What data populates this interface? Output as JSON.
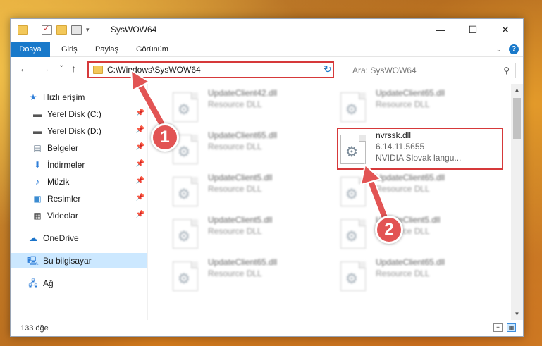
{
  "window": {
    "title": "SysWOW64",
    "controls": {
      "minimize": "—",
      "maximize": "☐",
      "close": "✕"
    }
  },
  "ribbon": {
    "tabs": [
      "Dosya",
      "Giriş",
      "Paylaş",
      "Görünüm"
    ],
    "accent": "#1979ca"
  },
  "nav": {
    "back": "←",
    "forward": "→",
    "recent": "⌄",
    "up": "↑",
    "address": "C:\\Windows\\SysWOW64",
    "search_placeholder": "Ara: SysWOW64"
  },
  "sidebar": {
    "items": [
      {
        "label": "Hızlı erişim",
        "icon": "star-icon",
        "pinned": false
      },
      {
        "label": "Yerel Disk (C:)",
        "icon": "drive-icon",
        "pinned": true
      },
      {
        "label": "Yerel Disk (D:)",
        "icon": "drive-icon",
        "pinned": true
      },
      {
        "label": "Belgeler",
        "icon": "documents-icon",
        "pinned": true
      },
      {
        "label": "İndirmeler",
        "icon": "download-icon",
        "pinned": true
      },
      {
        "label": "Müzik",
        "icon": "music-icon",
        "pinned": true
      },
      {
        "label": "Resimler",
        "icon": "pictures-icon",
        "pinned": true
      },
      {
        "label": "Videolar",
        "icon": "videos-icon",
        "pinned": true
      },
      {
        "label": "OneDrive",
        "icon": "cloud-icon",
        "pinned": false
      },
      {
        "label": "Bu bilgisayar",
        "icon": "computer-icon",
        "pinned": false,
        "selected": true
      },
      {
        "label": "Ağ",
        "icon": "network-icon",
        "pinned": false
      }
    ]
  },
  "files": {
    "left_column": [
      {
        "name": "UpdateClient42.dll",
        "desc": "Resource DLL"
      },
      {
        "name": "UpdateClient65.dll",
        "desc": "Resource DLL"
      },
      {
        "name": "UpdateClient5.dll",
        "desc": "Resource DLL"
      },
      {
        "name": "UpdateClient5.dll",
        "desc": "Resource DLL"
      },
      {
        "name": "UpdateClient65.dll",
        "desc": "Resource DLL"
      }
    ],
    "right_column": [
      {
        "name": "UpdateClient65.dll",
        "desc": "Resource DLL"
      },
      {
        "name": "UpdateClient65.dll",
        "desc": "Resource DLL"
      },
      {
        "name": "UpdateClient5.dll",
        "desc": "Resource DLL"
      },
      {
        "name": "UpdateClient65.dll",
        "desc": "Resource DLL"
      }
    ],
    "highlighted": {
      "name": "nvrssk.dll",
      "version": "6.14.11.5655",
      "desc": "NVIDIA Slovak langu..."
    }
  },
  "callouts": {
    "one": "1",
    "two": "2",
    "color": "#e25454"
  },
  "status": {
    "count": "133 öğe"
  }
}
